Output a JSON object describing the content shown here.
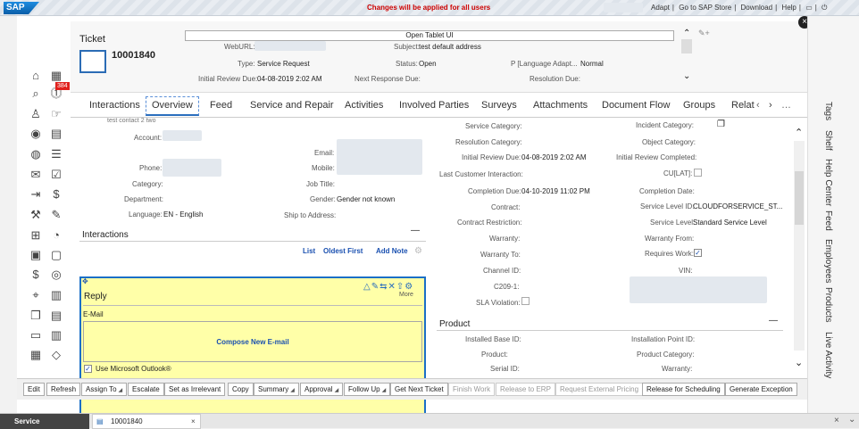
{
  "top": {
    "logo": "SAP",
    "message": "Changes will be applied for all users",
    "links": [
      "Adapt",
      "Go to SAP Store",
      "Download",
      "Help"
    ]
  },
  "header": {
    "title": "Ticket",
    "id": "10001840",
    "panel_label": "Open Tablet UI",
    "webUrl_label": "WebURL:",
    "type_label": "Type:",
    "type_value": "Service Request",
    "irdue_label": "Initial Review Due:",
    "irdue_value": "04-08-2019 2:02 AM",
    "subject_label": "Subject:",
    "subject_value": "test default address",
    "status_label": "Status:",
    "status_value": "Open",
    "nrdue_label": "Next Response Due:",
    "lang_label": "P [Language Adapt...",
    "lang_value": "Normal",
    "resdue_label": "Resolution Due:"
  },
  "nav": {
    "badge": "384"
  },
  "tabs": [
    "Interactions",
    "Overview",
    "Feed",
    "Service and Repair",
    "Activities",
    "Involved Parties",
    "Surveys",
    "Attachments",
    "Document Flow",
    "Groups",
    "Relat"
  ],
  "left": {
    "contact": "test contact 2 two",
    "account": "Account:",
    "email": "Email:",
    "phone": "Phone:",
    "mobile": "Mobile:",
    "category": "Category:",
    "jobtitle": "Job Title:",
    "department": "Department:",
    "gender_label": "Gender:",
    "gender_value": "Gender not known",
    "language_label": "Language:",
    "language_value": "EN - English",
    "shipto": "Ship to Address:"
  },
  "interactions": {
    "title": "Interactions",
    "list": "List",
    "oldest": "Oldest First",
    "addnote": "Add Note"
  },
  "reply": {
    "title": "Reply",
    "email": "E-Mail",
    "compose": "Compose New E-mail",
    "outlook": "Use Microsoft Outlook®",
    "more": "More"
  },
  "middle": [
    {
      "label": "Service Category:",
      "value": ""
    },
    {
      "label": "Resolution Category:",
      "value": ""
    },
    {
      "label": "Initial Review Due:",
      "value": "04-08-2019 2:02 AM"
    },
    {
      "label": "Last Customer Interaction:",
      "value": ""
    },
    {
      "label": "Completion Due:",
      "value": "04-10-2019 11:02 PM"
    },
    {
      "label": "Contract:",
      "value": ""
    },
    {
      "label": "Contract Restriction:",
      "value": ""
    },
    {
      "label": "Warranty:",
      "value": ""
    },
    {
      "label": "Warranty To:",
      "value": ""
    },
    {
      "label": "Channel ID:",
      "value": ""
    },
    {
      "label": "C209-1:",
      "value": ""
    },
    {
      "label": "SLA Violation:",
      "value": ""
    }
  ],
  "right": [
    {
      "label": "Incident Category:",
      "value": ""
    },
    {
      "label": "Object Category:",
      "value": ""
    },
    {
      "label": "Initial Review Completed:",
      "value": ""
    },
    {
      "label": "CU[LAT]:",
      "value": ""
    },
    {
      "label": "Completion Date:",
      "value": ""
    },
    {
      "label": "Service Level ID:",
      "value": "CLOUDFORSERVICE_ST..."
    },
    {
      "label": "Service Level:",
      "value": "Standard Service Level"
    },
    {
      "label": "Warranty From:",
      "value": ""
    },
    {
      "label": "Requires Work:",
      "value": ""
    },
    {
      "label": "VIN:",
      "value": ""
    }
  ],
  "product": {
    "title": "Product",
    "installed_base": "Installed Base ID:",
    "product": "Product:",
    "serial": "Serial ID:",
    "installation_point": "Installation Point ID:",
    "product_category": "Product Category:",
    "warranty": "Warranty:"
  },
  "toolbar": [
    "Edit",
    "Refresh",
    "Assign To",
    "Escalate",
    "Set as Irrelevant",
    "Copy",
    "Summary",
    "Approval",
    "Follow Up",
    "Get Next Ticket",
    "Finish Work",
    "Release to ERP",
    "Request External Pricing",
    "Release for Scheduling",
    "Generate Exception"
  ],
  "righttabs": [
    "Tags",
    "Shelf",
    "Help Center",
    "Feed",
    "Employees",
    "Products",
    "Live Activity"
  ],
  "taskbar": {
    "service": "Service",
    "ticket": "10001840"
  }
}
